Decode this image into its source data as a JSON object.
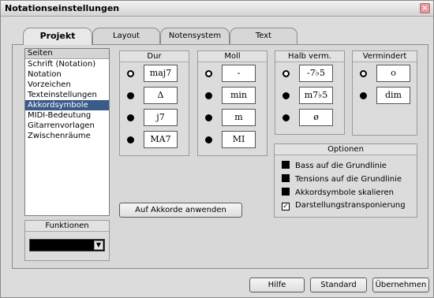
{
  "window": {
    "title": "Notationseinstellungen",
    "close_glyph": "×"
  },
  "tabs": [
    {
      "label": "Projekt",
      "active": true
    },
    {
      "label": "Layout",
      "active": false
    },
    {
      "label": "Notensystem",
      "active": false
    },
    {
      "label": "Text",
      "active": false
    }
  ],
  "seiten": {
    "header": "Seiten",
    "items": [
      "Schrift (Notation)",
      "Notation",
      "Vorzeichen",
      "Texteinstellungen",
      "Akkordsymbole",
      "MIDI-Bedeutung",
      "Gitarrenvorlagen",
      "Zwischenräume"
    ],
    "selected": "Akkordsymbole"
  },
  "groups": {
    "dur": {
      "header": "Dur",
      "options": [
        "maj7",
        "Δ",
        "j7",
        "MA7"
      ],
      "selected_index": 0
    },
    "moll": {
      "header": "Moll",
      "options": [
        "-",
        "min",
        "m",
        "MI"
      ],
      "selected_index": 0
    },
    "halb": {
      "header": "Halb verm.",
      "options": [
        "-7♭5",
        "m7♭5",
        "ø"
      ],
      "selected_index": 0
    },
    "verm": {
      "header": "Vermindert",
      "options": [
        "o",
        "dim"
      ],
      "selected_index": 0
    }
  },
  "optionen": {
    "header": "Optionen",
    "items": [
      {
        "label": "Bass auf die Grundlinie",
        "checked": false
      },
      {
        "label": "Tensions auf die Grundlinie",
        "checked": false
      },
      {
        "label": "Akkordsymbole skalieren",
        "checked": false
      },
      {
        "label": "Darstellungstransponierung",
        "checked": true
      }
    ],
    "check_glyph": "✓"
  },
  "apply_button": "Auf Akkorde anwenden",
  "funktionen": {
    "header": "Funktionen",
    "arrow_glyph": "▼"
  },
  "footer": {
    "hilfe": "Hilfe",
    "standard": "Standard",
    "uebernehmen": "Übernehmen"
  }
}
